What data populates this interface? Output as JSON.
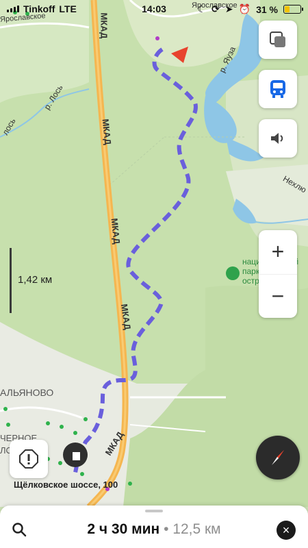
{
  "status_bar": {
    "carrier": "Tinkoff",
    "network": "LTE",
    "time": "14:03",
    "battery": "31 %"
  },
  "map": {
    "scale_label": "1,42 км",
    "road_label_mkad": "МКАД",
    "river_los": "р. Лось",
    "river_los_partial": "лось",
    "river_yauza": "р. Яуза",
    "street_top": "Ярославское",
    "street_top_left": "Ярославское",
    "neckl_label": "Нехлю",
    "park_name_line1": "национальный",
    "park_name_line2": "парк Лосиный",
    "park_name_line3": "остров",
    "district_left": "АЛЬЯНОВО",
    "district_left_b1": "ЧЕРНОЕ",
    "district_left_b2": "ЛО",
    "address_label": "Щёлковское шоссе, 100",
    "colors": {
      "forest": "#c7e0ad",
      "field": "#dde9c9",
      "road": "#f5b650",
      "water": "#8ec6e6",
      "route": "#6a5fdc",
      "urban": "#ececea"
    }
  },
  "controls": {
    "layers_icon": "layers-icon",
    "transport_icon": "bus-icon",
    "sound_icon": "speaker-icon",
    "zoom_in": "+",
    "zoom_out": "−",
    "alert_icon": "alert-icon",
    "compass_icon": "compass-icon"
  },
  "bottom_bar": {
    "route_time": "2 ч 30 мин",
    "separator": " • ",
    "route_distance": "12,5 км",
    "close_label": "×"
  }
}
